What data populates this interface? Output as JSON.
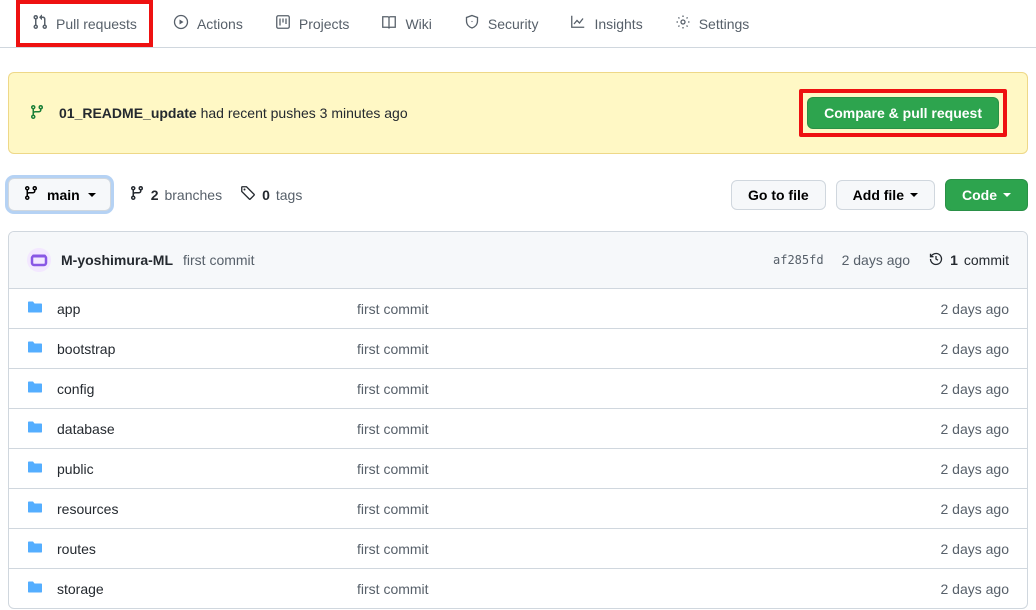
{
  "nav": {
    "tabs": [
      {
        "label": "Pull requests"
      },
      {
        "label": "Actions"
      },
      {
        "label": "Projects"
      },
      {
        "label": "Wiki"
      },
      {
        "label": "Security"
      },
      {
        "label": "Insights"
      },
      {
        "label": "Settings"
      }
    ]
  },
  "alert": {
    "branch": "01_README_update",
    "suffix_text": " had recent pushes 3 minutes ago",
    "button_label": "Compare & pull request"
  },
  "branch_selector": {
    "current": "main"
  },
  "stats": {
    "branches_count": "2",
    "branches_label": "branches",
    "tags_count": "0",
    "tags_label": "tags"
  },
  "actions": {
    "go_to_file": "Go to file",
    "add_file": "Add file",
    "code": "Code"
  },
  "latest_commit": {
    "author": "M-yoshimura-ML",
    "message": "first commit",
    "sha": "af285fd",
    "ago": "2 days ago",
    "commits_count": "1",
    "commits_label": "commit"
  },
  "files": [
    {
      "name": "app",
      "message": "first commit",
      "ago": "2 days ago"
    },
    {
      "name": "bootstrap",
      "message": "first commit",
      "ago": "2 days ago"
    },
    {
      "name": "config",
      "message": "first commit",
      "ago": "2 days ago"
    },
    {
      "name": "database",
      "message": "first commit",
      "ago": "2 days ago"
    },
    {
      "name": "public",
      "message": "first commit",
      "ago": "2 days ago"
    },
    {
      "name": "resources",
      "message": "first commit",
      "ago": "2 days ago"
    },
    {
      "name": "routes",
      "message": "first commit",
      "ago": "2 days ago"
    },
    {
      "name": "storage",
      "message": "first commit",
      "ago": "2 days ago"
    }
  ]
}
